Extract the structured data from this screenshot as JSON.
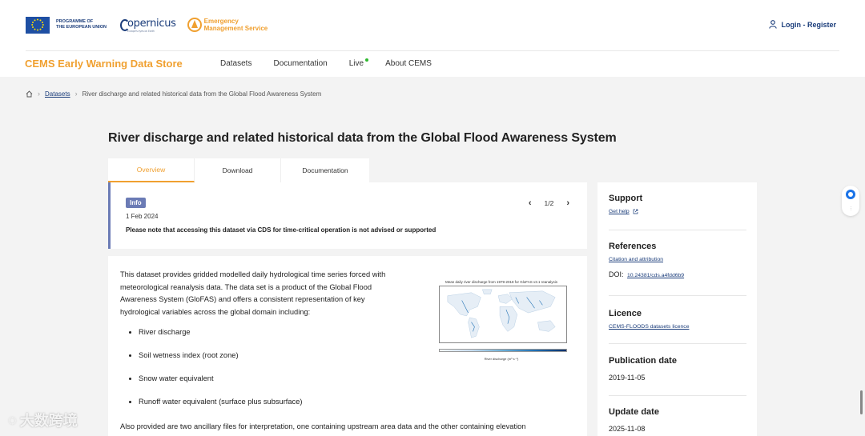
{
  "header": {
    "eu_text": [
      "PROGRAMME OF",
      "THE EUROPEAN UNION"
    ],
    "copernicus_text": "opernicus",
    "copernicus_sub": "Europe's eyes on Earth",
    "cems_text": [
      "Emergency",
      "Management Service"
    ],
    "login_label": "Login - Register"
  },
  "brand": "CEMS Early Warning Data Store",
  "nav": {
    "items": [
      "Datasets",
      "Documentation",
      "Live",
      "About CEMS"
    ]
  },
  "breadcrumb": {
    "datasets": "Datasets",
    "current": "River discharge and related historical data from the Global Flood Awareness System"
  },
  "page_title": "River discharge and related historical data from the Global Flood Awareness System",
  "tabs": [
    "Overview",
    "Download",
    "Documentation"
  ],
  "info": {
    "badge": "Info",
    "date": "1 Feb 2024",
    "message": "Please note that accessing this dataset via CDS for time-critical operation is not advised or supported",
    "pager": "1/2"
  },
  "content": {
    "paragraph": "This dataset provides gridded modelled daily hydrological time series forced with meteorological reanalysis data. The data set is a product of the Global Flood Awareness System (GloFAS) and offers a consistent representation of key hydrological variables across the global domain including:",
    "bullets": [
      "River discharge",
      "Soil wetness index (root zone)",
      "Snow water equivalent",
      "Runoff water equivalent (surface plus subsurface)"
    ],
    "paragraph2": "Also provided are two ancillary files for interpretation, one containing upstream area data and the other containing elevation",
    "figure_title": "Mean daily river discharge from 1979-2018 for GloFAS v3.1 reanalysis",
    "colorbar_label": "River discharge (m³ s⁻¹)"
  },
  "sidebar": {
    "support": {
      "title": "Support",
      "link": "Get help"
    },
    "references": {
      "title": "References",
      "link": "Citation and attribution",
      "doi_label": "DOI:",
      "doi_value": "10.24381/cds.a4fdd6b9"
    },
    "licence": {
      "title": "Licence",
      "link": "CEMS-FLOODS datasets licence"
    },
    "publication": {
      "title": "Publication date",
      "value": "2019-11-05"
    },
    "update": {
      "title": "Update date",
      "value": "2025-11-08"
    }
  },
  "watermark": "大数跨境",
  "colors": {
    "accent": "#f0a030",
    "link": "#1a3c7a",
    "info": "#6b7bb5",
    "live": "#2eb82e"
  }
}
